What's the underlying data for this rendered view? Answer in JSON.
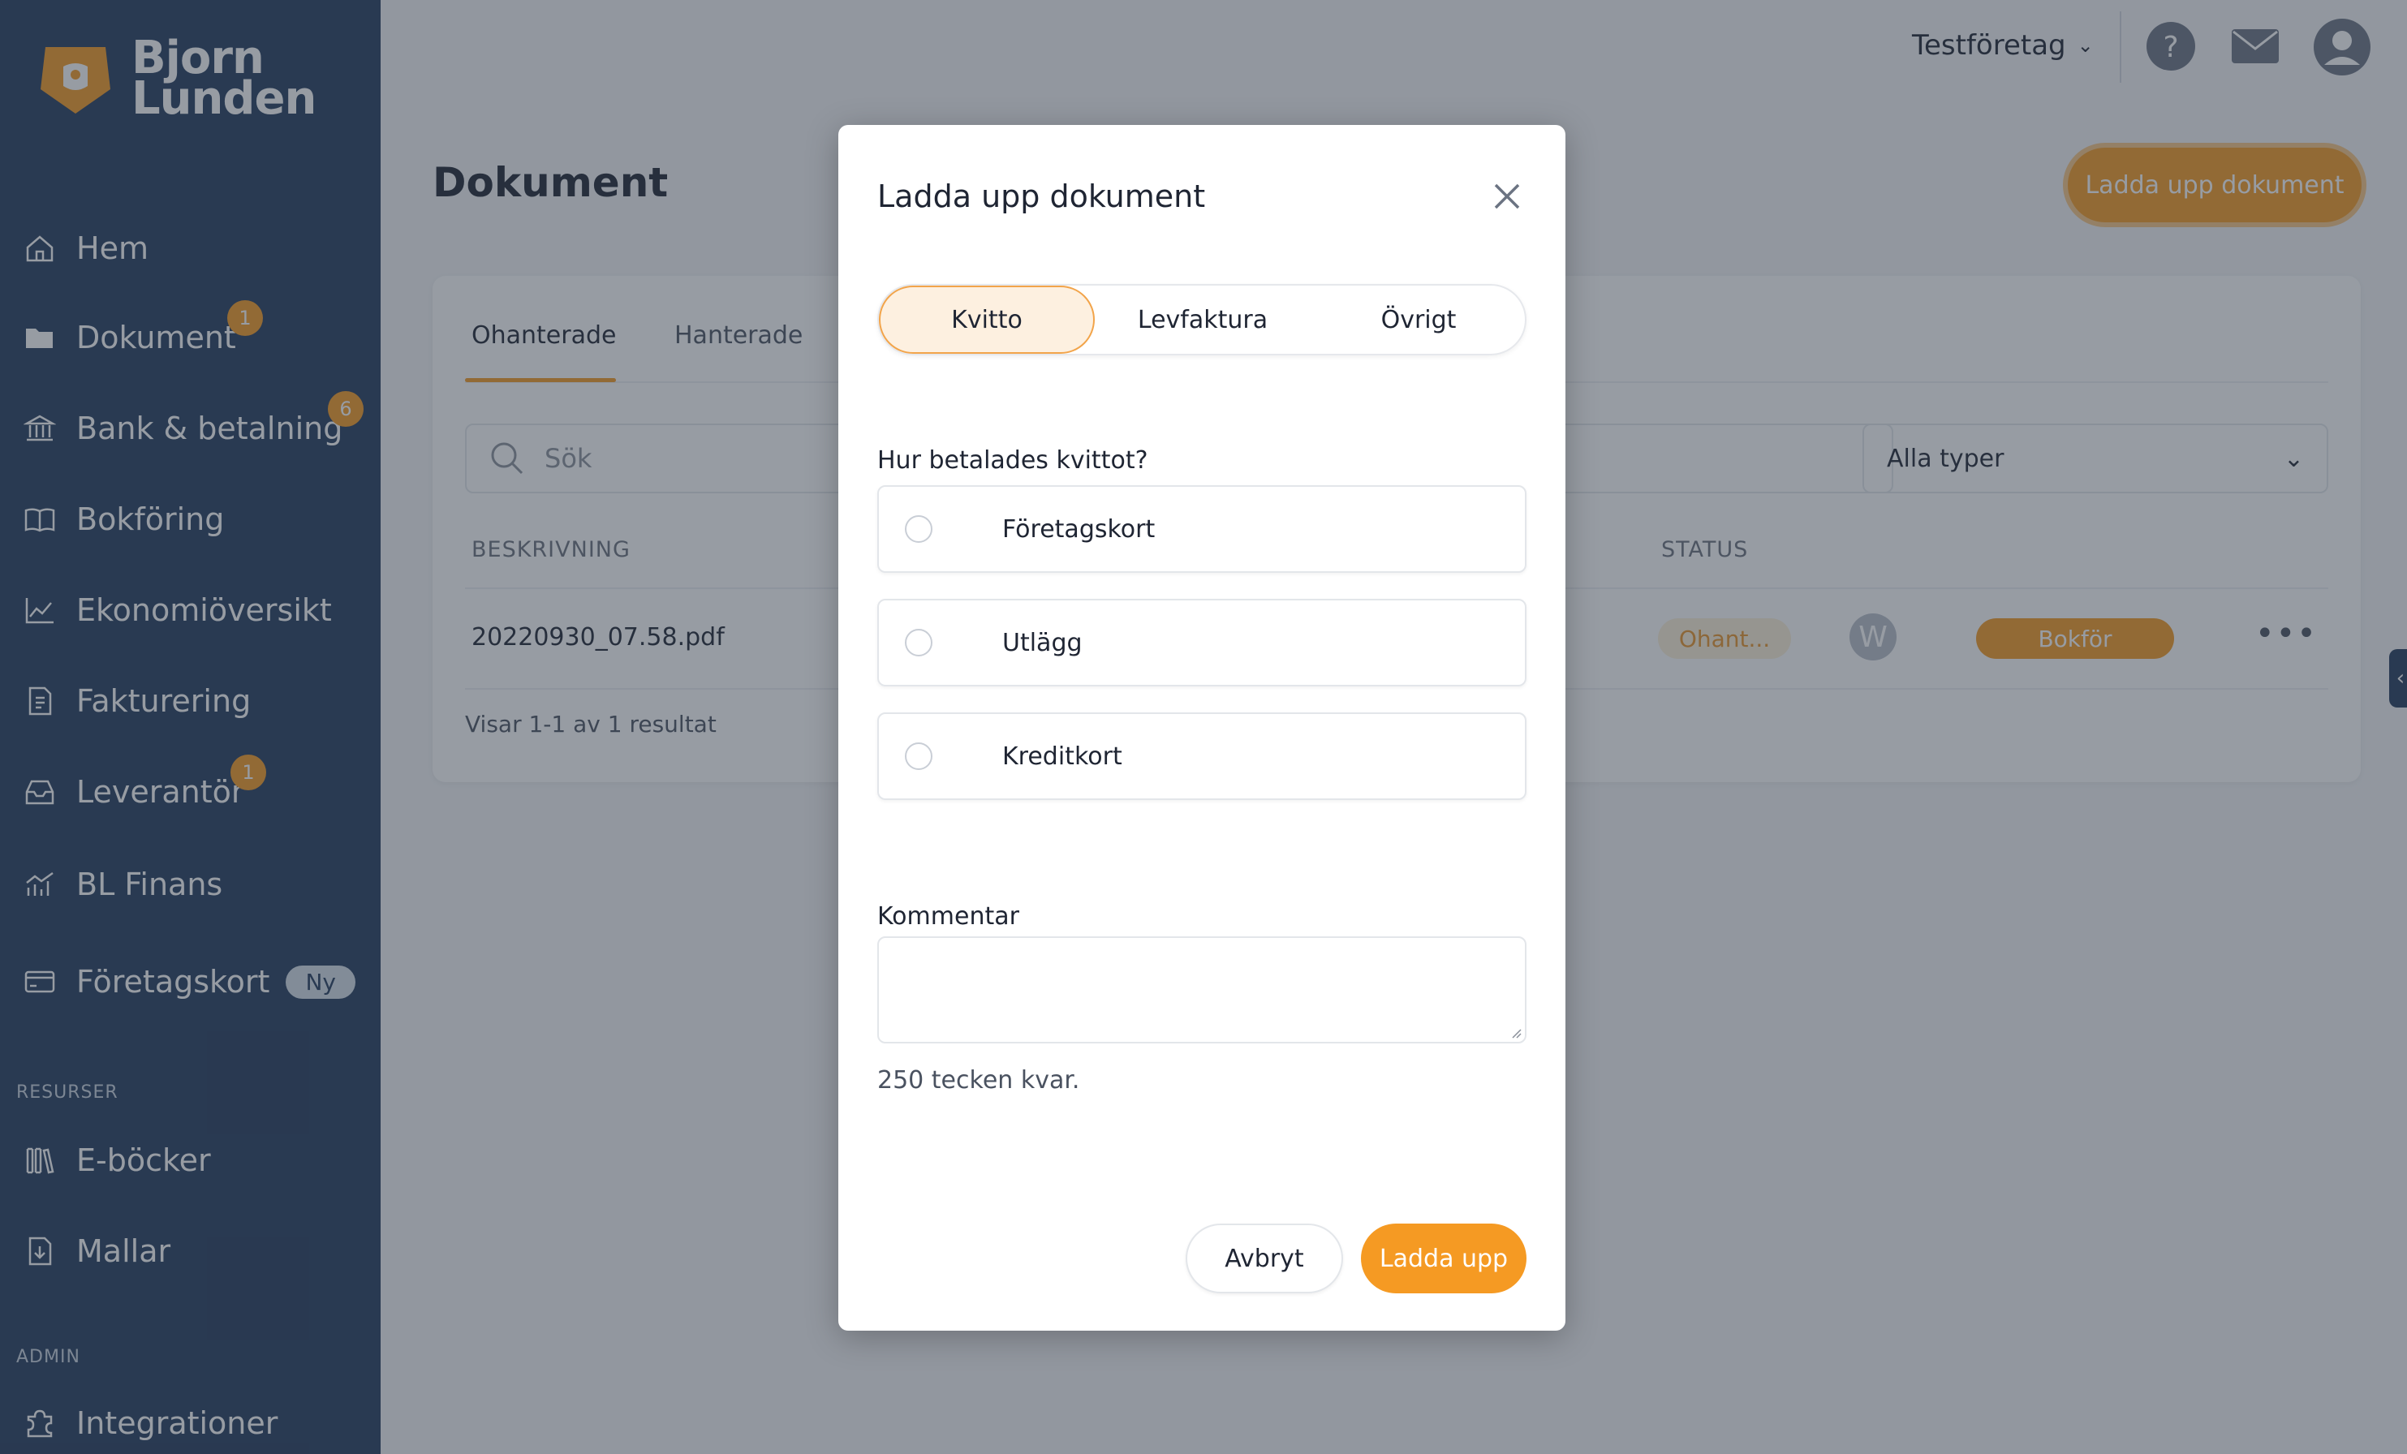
{
  "brand": {
    "line1": "Bjorn",
    "line2": "Lunden"
  },
  "sidebar": {
    "items": [
      {
        "label": "Hem"
      },
      {
        "label": "Dokument",
        "badge": "1"
      },
      {
        "label": "Bank & betalning",
        "badge": "6"
      },
      {
        "label": "Bokföring"
      },
      {
        "label": "Ekonomiöversikt"
      },
      {
        "label": "Fakturering"
      },
      {
        "label": "Leverantör",
        "badge": "1"
      },
      {
        "label": "BL Finans"
      },
      {
        "label": "Företagskort",
        "tag": "Ny"
      }
    ],
    "resources_label": "RESURSER",
    "resources": [
      {
        "label": "E-böcker"
      },
      {
        "label": "Mallar"
      }
    ],
    "admin_label": "ADMIN",
    "admin": [
      {
        "label": "Integrationer"
      }
    ]
  },
  "topbar": {
    "company": "Testföretag"
  },
  "page": {
    "title": "Dokument",
    "upload_button": "Ladda upp dokument",
    "tabs": [
      {
        "label": "Ohanterade"
      },
      {
        "label": "Hanterade"
      }
    ],
    "search_placeholder": "Sök",
    "type_filter": "Alla typer",
    "columns": {
      "description": "BESKRIVNING",
      "status": "STATUS"
    },
    "rows": [
      {
        "description": "20220930_07.58.pdf",
        "status": "Ohant...",
        "avatar": "W",
        "action": "Bokför"
      }
    ],
    "result_text": "Visar 1-1 av 1 resultat"
  },
  "modal": {
    "title": "Ladda upp dokument",
    "segments": [
      {
        "label": "Kvitto"
      },
      {
        "label": "Levfaktura"
      },
      {
        "label": "Övrigt"
      }
    ],
    "question": "Hur betalades kvittot?",
    "options": [
      {
        "label": "Företagskort"
      },
      {
        "label": "Utlägg"
      },
      {
        "label": "Kreditkort"
      }
    ],
    "comment_label": "Kommentar",
    "chars_left": "250 tecken kvar.",
    "cancel": "Avbryt",
    "upload": "Ladda upp"
  },
  "colors": {
    "sidebar": "#223a5c",
    "accent": "#f59a23",
    "overlay": "rgba(48,57,71,0.5)"
  }
}
